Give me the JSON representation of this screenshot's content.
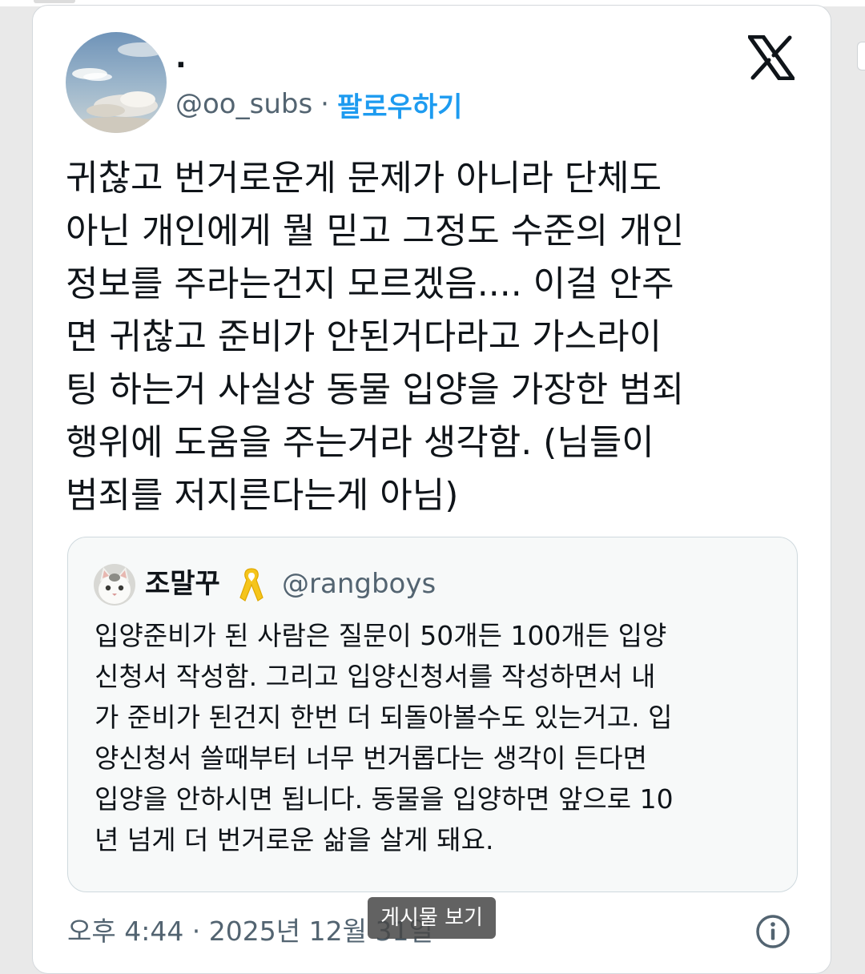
{
  "tweet": {
    "author_name": "·",
    "handle": "@oo_subs",
    "separator": "·",
    "follow_label": "팔로우하기",
    "text_lines": [
      "귀찮고 번거로운게 문제가 아니라 단체도",
      "아닌 개인에게 뭘 믿고 그정도 수준의 개인",
      "정보를 주라는건지 모르겠음.... 이걸 안주",
      "면 귀찮고 준비가 안된거다라고 가스라이",
      "팅 하는거 사실상 동물 입양을 가장한 범죄",
      "행위에 도움을 주는거라 생각함. (님들이",
      "범죄를 저지른다는게 아님)"
    ],
    "timestamp": "오후 4:44 · 2025년 12월 31일"
  },
  "quoted_tweet": {
    "author_name": "조말꾸",
    "handle": "@rangboys",
    "text_lines": [
      "입양준비가 된 사람은 질문이 50개든 100개든 입양",
      "신청서 작성함. 그리고 입양신청서를 작성하면서 내",
      "가 준비가 된건지 한번 더 되돌아볼수도 있는거고. 입",
      "양신청서 쓸때부터 너무 번거롭다는 생각이 든다면",
      "입양을 안하시면 됩니다. 동물을 입양하면 앞으로 10",
      "년 넘게 더 번거로운 삶을 살게 돼요."
    ]
  },
  "toast": {
    "label": "게시물 보기"
  },
  "icons": {
    "brand": "x-logo-icon",
    "ribbon": "yellow-ribbon-icon",
    "info": "info-icon"
  },
  "colors": {
    "link": "#1d9bf0",
    "secondary_text": "#536471",
    "primary_text": "#0f1419",
    "ribbon": "#f5c51b"
  }
}
